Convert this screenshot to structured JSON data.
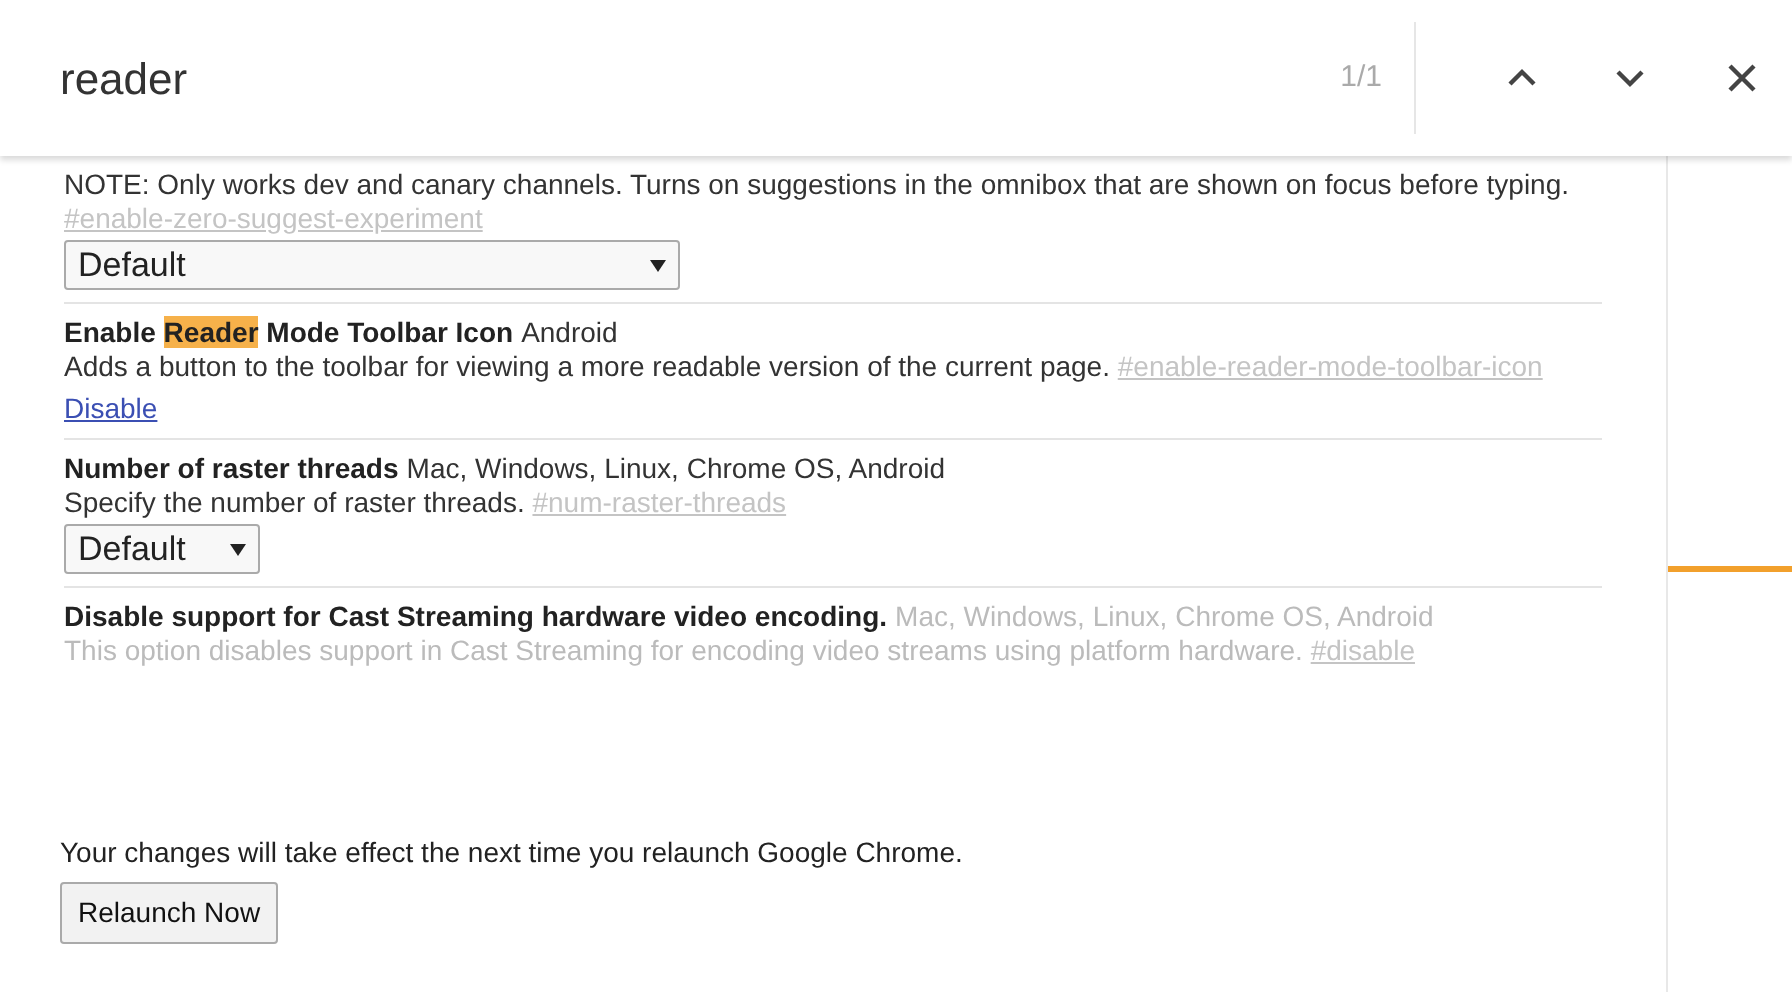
{
  "find_bar": {
    "query": "reader",
    "match_count": "1/1"
  },
  "flags": [
    {
      "description": "NOTE: Only works dev and canary channels. Turns on suggestions in the omnibox that are shown on focus before typing.",
      "link": "#enable-zero-suggest-experiment",
      "control": {
        "kind": "select",
        "value": "Default",
        "wide": true
      },
      "dimmed": false
    },
    {
      "title": "Enable **Reader** Mode Toolbar Icon",
      "platforms": "Android",
      "description": "Adds a button to the toolbar for viewing a more readable version of the current page.",
      "link": "#enable-reader-mode-toolbar-icon",
      "control": {
        "kind": "link",
        "value": "Disable"
      },
      "dimmed": false
    },
    {
      "title": "Number of raster threads",
      "platforms": "Mac, Windows, Linux, Chrome OS, Android",
      "description": "Specify the number of raster threads.",
      "link": "#num-raster-threads",
      "control": {
        "kind": "select",
        "value": "Default",
        "wide": false
      },
      "dimmed": false
    },
    {
      "title": "Disable support for Cast Streaming hardware video encoding.",
      "platforms": "Mac, Windows, Linux, Chrome OS, Android",
      "description": "This option disables support in Cast Streaming for encoding video streams using platform hardware.",
      "link": "#disable",
      "dimmed": true
    }
  ],
  "footer": {
    "message": "Your changes will take effect the next time you relaunch Google Chrome.",
    "button": "Relaunch Now"
  }
}
